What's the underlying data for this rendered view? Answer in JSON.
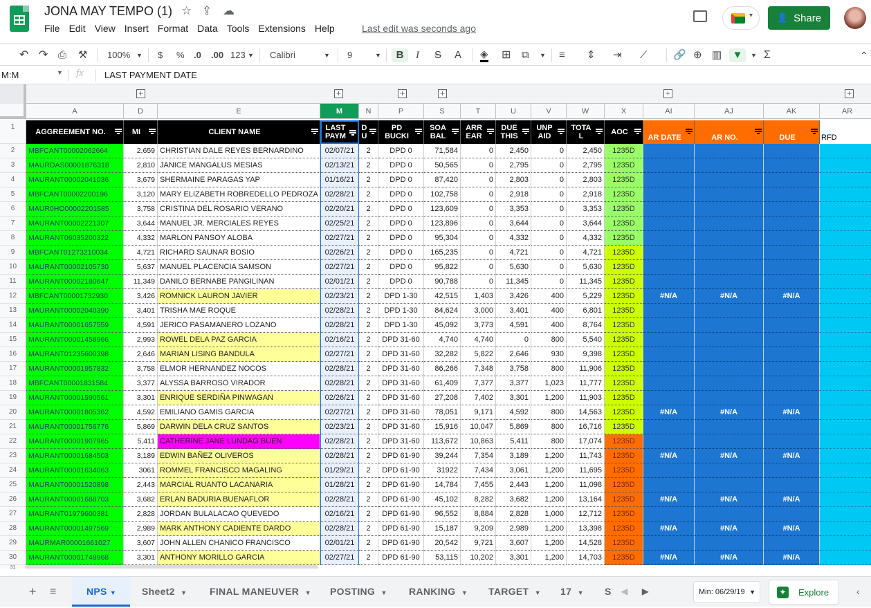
{
  "doc": {
    "title": "JONA MAY TEMPO (1)",
    "last_edit": "Last edit was seconds ago",
    "share": "Share"
  },
  "menu": [
    "File",
    "Edit",
    "View",
    "Insert",
    "Format",
    "Data",
    "Tools",
    "Extensions",
    "Help"
  ],
  "toolbar": {
    "zoom": "100%",
    "currency": "$",
    "percent": "%",
    "dec_less": ".0",
    "dec_more": ".00",
    "format": "123",
    "font": "Calibri",
    "size": "9"
  },
  "formula": {
    "namebox": "M:M",
    "fx": "fx",
    "content": "LAST PAYMENT DATE"
  },
  "columns": [
    "A",
    "D",
    "E",
    "M",
    "N",
    "P",
    "S",
    "T",
    "U",
    "V",
    "W",
    "X",
    "AI",
    "AJ",
    "AK",
    "AR"
  ],
  "headers": [
    "AGGREEMENT NO.",
    "MI",
    "CLIENT NAME",
    "LAST PAYM",
    "D U",
    "PD BUCKI",
    "SOA BAL",
    "ARR EAR",
    "DUE THIS",
    "UNP AID",
    "TOTA L",
    "AOC",
    "AR DATE",
    "AR NO.",
    "DUE",
    "RFD"
  ],
  "rows": [
    {
      "n": "2",
      "agr": "MBFCANT00002062664",
      "mi": "2,659",
      "name": "CHRISTIAN DALE REYES BERNARDINO",
      "date": "02/07/21",
      "du": "2",
      "bucket": "DPD 0",
      "soa": "71,584",
      "arr": "0",
      "due": "2,450",
      "unp": "0",
      "tot": "2,450",
      "aoc": "1235D",
      "na": false
    },
    {
      "n": "3",
      "agr": "MAURDAS00001876318",
      "mi": "2,810",
      "name": "JANICE MANGALUS MESIAS",
      "date": "02/13/21",
      "du": "2",
      "bucket": "DPD 0",
      "soa": "50,565",
      "arr": "0",
      "due": "2,795",
      "unp": "0",
      "tot": "2,795",
      "aoc": "1235D",
      "na": false
    },
    {
      "n": "4",
      "agr": "MAURANT00002041036",
      "mi": "3,679",
      "name": "SHERMAINE PARAGAS YAP",
      "date": "01/16/21",
      "du": "2",
      "bucket": "DPD 0",
      "soa": "87,420",
      "arr": "0",
      "due": "2,803",
      "unp": "0",
      "tot": "2,803",
      "aoc": "1235D",
      "na": false
    },
    {
      "n": "5",
      "agr": "MBFCANT00002200196",
      "mi": "3,120",
      "name": "MARY ELIZABETH ROBREDELLO PEDROZA",
      "date": "02/28/21",
      "du": "2",
      "bucket": "DPD 0",
      "soa": "102,758",
      "arr": "0",
      "due": "2,918",
      "unp": "0",
      "tot": "2,918",
      "aoc": "1235D",
      "na": false
    },
    {
      "n": "6",
      "agr": "MAUR0HO00002201585",
      "mi": "3,758",
      "name": "CRISTINA DEL ROSARIO VERANO",
      "date": "02/20/21",
      "du": "2",
      "bucket": "DPD 0",
      "soa": "123,609",
      "arr": "0",
      "due": "3,353",
      "unp": "0",
      "tot": "3,353",
      "aoc": "1235D",
      "na": false
    },
    {
      "n": "7",
      "agr": "MAURANT00002221307",
      "mi": "3,644",
      "name": "MANUEL JR. MERCIALES REYES",
      "date": "02/25/21",
      "du": "2",
      "bucket": "DPD 0",
      "soa": "123,896",
      "arr": "0",
      "due": "3,644",
      "unp": "0",
      "tot": "3,644",
      "aoc": "1235D",
      "na": false
    },
    {
      "n": "8",
      "agr": "MAURANT06035200322",
      "mi": "4,332",
      "name": "MARLON PANSOY ALOBA",
      "date": "02/27/21",
      "du": "2",
      "bucket": "DPD 0",
      "soa": "95,304",
      "arr": "0",
      "due": "4,332",
      "unp": "0",
      "tot": "4,332",
      "aoc": "1235D",
      "na": false
    },
    {
      "n": "9",
      "agr": "MBFCANT01273210034",
      "mi": "4,721",
      "name": "RICHARD SAUNAR BOSIO",
      "date": "02/26/21",
      "du": "2",
      "bucket": "DPD 0",
      "soa": "165,235",
      "arr": "0",
      "due": "4,721",
      "unp": "0",
      "tot": "4,721",
      "aoc": "1235D",
      "na": false
    },
    {
      "n": "10",
      "agr": "MAURANT00002105730",
      "mi": "5,637",
      "name": "MANUEL PLACENCIA SAMSON",
      "date": "02/27/21",
      "du": "2",
      "bucket": "DPD 0",
      "soa": "95,822",
      "arr": "0",
      "due": "5,630",
      "unp": "0",
      "tot": "5,630",
      "aoc": "1235D",
      "na": false
    },
    {
      "n": "11",
      "agr": "MAURANT00002180647",
      "mi": "11,349",
      "name": "DANILO BERNABE PANGILINAN",
      "date": "02/01/21",
      "du": "2",
      "bucket": "DPD 0",
      "soa": "90,788",
      "arr": "0",
      "due": "11,345",
      "unp": "0",
      "tot": "11,345",
      "aoc": "1235D",
      "na": false
    },
    {
      "n": "12",
      "agr": "MBFCANT00001732930",
      "mi": "3,426",
      "name": "ROMNICK LAURON JAVIER",
      "date": "02/23/21",
      "du": "2",
      "bucket": "DPD 1-30",
      "soa": "42,515",
      "arr": "1,403",
      "due": "3,426",
      "unp": "400",
      "tot": "5,229",
      "aoc": "1235D",
      "na": true
    },
    {
      "n": "13",
      "agr": "MAURANT00002040390",
      "mi": "3,401",
      "name": "TRISHA MAE  ROQUE",
      "date": "02/28/21",
      "du": "2",
      "bucket": "DPD 1-30",
      "soa": "84,624",
      "arr": "3,000",
      "due": "3,401",
      "unp": "400",
      "tot": "6,801",
      "aoc": "1235D",
      "na": false
    },
    {
      "n": "14",
      "agr": "MAURANT00001657559",
      "mi": "4,591",
      "name": "JERICO PASAMANERO LOZANO",
      "date": "02/28/21",
      "du": "2",
      "bucket": "DPD 1-30",
      "soa": "45,092",
      "arr": "3,773",
      "due": "4,591",
      "unp": "400",
      "tot": "8,764",
      "aoc": "1235D",
      "na": false
    },
    {
      "n": "15",
      "agr": "MAURANT00001458966",
      "mi": "2,993",
      "name": "ROWEL DELA PAZ GARCIA",
      "date": "02/16/21",
      "du": "2",
      "bucket": "DPD 31-60",
      "soa": "4,740",
      "arr": "4,740",
      "due": "0",
      "unp": "800",
      "tot": "5,540",
      "aoc": "1235D",
      "na": false
    },
    {
      "n": "16",
      "agr": "MAURANT01235600398",
      "mi": "2,646",
      "name": "MARIAN LISING BANDULA",
      "date": "02/27/21",
      "du": "2",
      "bucket": "DPD 31-60",
      "soa": "32,282",
      "arr": "5,822",
      "due": "2,646",
      "unp": "930",
      "tot": "9,398",
      "aoc": "1235D",
      "na": false
    },
    {
      "n": "17",
      "agr": "MAURANT00001957832",
      "mi": "3,758",
      "name": "ELMOR HERNANDEZ NOCOS",
      "date": "02/28/21",
      "du": "2",
      "bucket": "DPD 31-60",
      "soa": "86,266",
      "arr": "7,348",
      "due": "3,758",
      "unp": "800",
      "tot": "11,906",
      "aoc": "1235D",
      "na": false
    },
    {
      "n": "18",
      "agr": "MBFCANT00001831584",
      "mi": "3,377",
      "name": "ALYSSA BARROSO VIRADOR",
      "date": "02/28/21",
      "du": "2",
      "bucket": "DPD 31-60",
      "soa": "61,409",
      "arr": "7,377",
      "due": "3,377",
      "unp": "1,023",
      "tot": "11,777",
      "aoc": "1235D",
      "na": false
    },
    {
      "n": "19",
      "agr": "MAURANT00001590561",
      "mi": "3,301",
      "name": "ENRIQUE SERDIÑA PINWAGAN",
      "date": "02/26/21",
      "du": "2",
      "bucket": "DPD 31-60",
      "soa": "27,208",
      "arr": "7,402",
      "due": "3,301",
      "unp": "1,200",
      "tot": "11,903",
      "aoc": "1235D",
      "na": false
    },
    {
      "n": "20",
      "agr": "MAURANT00001805362",
      "mi": "4,592",
      "name": "EMILIANO GAMIS GARCIA",
      "date": "02/27/21",
      "du": "2",
      "bucket": "DPD 31-60",
      "soa": "78,051",
      "arr": "9,171",
      "due": "4,592",
      "unp": "800",
      "tot": "14,563",
      "aoc": "1235D",
      "na": true
    },
    {
      "n": "21",
      "agr": "MAURANT00001756776",
      "mi": "5,869",
      "name": "DARWIN DELA CRUZ SANTOS",
      "date": "02/23/21",
      "du": "2",
      "bucket": "DPD 31-60",
      "soa": "15,916",
      "arr": "10,047",
      "due": "5,869",
      "unp": "800",
      "tot": "16,716",
      "aoc": "1235D",
      "na": false
    },
    {
      "n": "22",
      "agr": "MAURANT00001907965",
      "mi": "5,411",
      "name": "CATHERINE JANE LUNDAG BUEN",
      "date": "02/28/21",
      "du": "2",
      "bucket": "DPD 31-60",
      "soa": "113,672",
      "arr": "10,863",
      "due": "5,411",
      "unp": "800",
      "tot": "17,074",
      "aoc": "1235D",
      "na": false
    },
    {
      "n": "23",
      "agr": "MAURANT00001684503",
      "mi": "3,189",
      "name": "EDWIN BAÑEZ OLIVEROS",
      "date": "02/28/21",
      "du": "2",
      "bucket": "DPD 61-90",
      "soa": "39,244",
      "arr": "7,354",
      "due": "3,189",
      "unp": "1,200",
      "tot": "11,743",
      "aoc": "1235D",
      "na": true
    },
    {
      "n": "24",
      "agr": "MAURANT00001634063",
      "mi": "3061",
      "name": "ROMMEL FRANCISCO MAGALING",
      "date": "01/29/21",
      "du": "2",
      "bucket": "DPD 61-90",
      "soa": "31922",
      "arr": "7,434",
      "due": "3,061",
      "unp": "1,200",
      "tot": "11,695",
      "aoc": "1235D",
      "na": false
    },
    {
      "n": "25",
      "agr": "MAURANT00001520898",
      "mi": "2,443",
      "name": "MARCIAL RUANTO LACANARIA",
      "date": "01/28/21",
      "du": "2",
      "bucket": "DPD 61-90",
      "soa": "14,784",
      "arr": "7,455",
      "due": "2,443",
      "unp": "1,200",
      "tot": "11,098",
      "aoc": "1235D",
      "na": false
    },
    {
      "n": "26",
      "agr": "MAURANT00001688703",
      "mi": "3,682",
      "name": "ERLAN BADURIA BUENAFLOR",
      "date": "02/28/21",
      "du": "2",
      "bucket": "DPD 61-90",
      "soa": "45,102",
      "arr": "8,282",
      "due": "3,682",
      "unp": "1,200",
      "tot": "13,164",
      "aoc": "1235D",
      "na": true
    },
    {
      "n": "27",
      "agr": "MAURANT01979600381",
      "mi": "2,828",
      "name": "JORDAN BULALACAO QUEVEDO",
      "date": "02/16/21",
      "du": "2",
      "bucket": "DPD 61-90",
      "soa": "96,552",
      "arr": "8,884",
      "due": "2,828",
      "unp": "1,000",
      "tot": "12,712",
      "aoc": "1235D",
      "na": false
    },
    {
      "n": "28",
      "agr": "MAURANT00001497569",
      "mi": "2,989",
      "name": "MARK ANTHONY CADIENTE DARDO",
      "date": "02/28/21",
      "du": "2",
      "bucket": "DPD 61-90",
      "soa": "15,187",
      "arr": "9,209",
      "due": "2,989",
      "unp": "1,200",
      "tot": "13,398",
      "aoc": "1235D",
      "na": true
    },
    {
      "n": "29",
      "agr": "MAURMAR00001661027",
      "mi": "3,607",
      "name": "JOHN ALLEN CHANICO FRANCISCO",
      "date": "02/01/21",
      "du": "2",
      "bucket": "DPD 61-90",
      "soa": "20,542",
      "arr": "9,721",
      "due": "3,607",
      "unp": "1,200",
      "tot": "14,528",
      "aoc": "1235D",
      "na": false
    },
    {
      "n": "30",
      "agr": "MAURANT00001748968",
      "mi": "3,301",
      "name": "ANTHONY MORILLO GARCIA",
      "date": "02/27/21",
      "du": "2",
      "bucket": "DPD 61-90",
      "soa": "53,115",
      "arr": "10,202",
      "due": "3,301",
      "unp": "1,200",
      "tot": "14,703",
      "aoc": "1235D",
      "na": true
    }
  ],
  "na_text": "#N/A",
  "header_row_number": "1",
  "partial_row_number": "31",
  "tabs": [
    "NPS",
    "Sheet2",
    "FINAL MANEUVER",
    "POSTING",
    "RANKING",
    "TARGET",
    "17",
    "S"
  ],
  "status": {
    "min": "Min: 06/29/19",
    "explore": "Explore"
  },
  "colors": {
    "green": "#00ff00",
    "yellow": "#ffff99",
    "magenta": "#ff00ff",
    "lightgreen": "#99ff66",
    "lime": "#ccff00",
    "orange": "#ff6d01",
    "blue": "#1c76d2",
    "cyan": "#00c8f5",
    "share": "#188038"
  }
}
